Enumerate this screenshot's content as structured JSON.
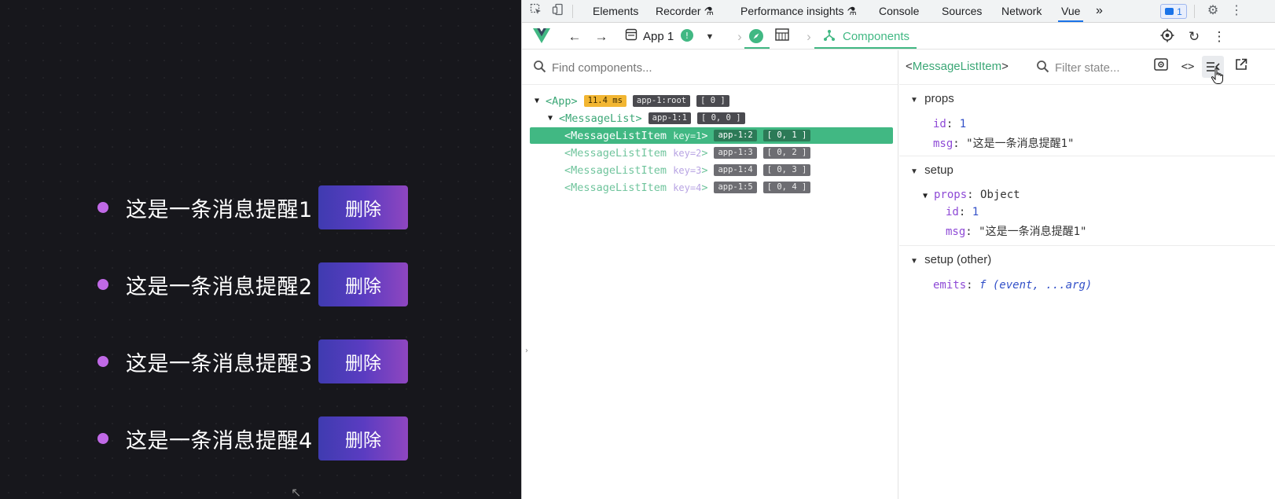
{
  "app": {
    "messages": [
      {
        "text": "这是一条消息提醒1",
        "delete_label": "删除"
      },
      {
        "text": "这是一条消息提醒2",
        "delete_label": "删除"
      },
      {
        "text": "这是一条消息提醒3",
        "delete_label": "删除"
      },
      {
        "text": "这是一条消息提醒4",
        "delete_label": "删除"
      }
    ]
  },
  "devtools": {
    "tabs": [
      {
        "label": "Elements"
      },
      {
        "label": "Recorder ⚗"
      },
      {
        "label": "Performance insights ⚗"
      },
      {
        "label": "Console"
      },
      {
        "label": "Sources"
      },
      {
        "label": "Network"
      },
      {
        "label": "Vue",
        "active": true
      }
    ],
    "more_tabs": "»",
    "issues_count": "1",
    "vue_toolbar": {
      "app_label": "App 1",
      "section_label": "Components"
    },
    "find_placeholder": "Find components...",
    "tree": [
      {
        "tag": "<App>",
        "badges": [
          "11.4 ms",
          "app-1:root",
          "[ 0 ]"
        ]
      },
      {
        "tag": "<MessageList>",
        "badges": [
          "app-1:1",
          "[ 0, 0 ]"
        ]
      },
      {
        "tag": "<MessageListItem",
        "key": "key=1",
        "close": ">",
        "badges": [
          "app-1:2",
          "[ 0, 1 ]"
        ],
        "selected": true
      },
      {
        "tag": "<MessageListItem",
        "key": "key=2",
        "close": ">",
        "badges": [
          "app-1:3",
          "[ 0, 2 ]"
        ]
      },
      {
        "tag": "<MessageListItem",
        "key": "key=3",
        "close": ">",
        "badges": [
          "app-1:4",
          "[ 0, 3 ]"
        ]
      },
      {
        "tag": "<MessageListItem",
        "key": "key=4",
        "close": ">",
        "badges": [
          "app-1:5",
          "[ 0, 4 ]"
        ]
      }
    ],
    "inspector": {
      "component_open": "<",
      "component_name": "MessageListItem",
      "component_close": ">",
      "filter_placeholder": "Filter state...",
      "sections": {
        "props": {
          "title": "props",
          "id_key": "id",
          "id_value": "1",
          "msg_key": "msg",
          "msg_value": "\"这是一条消息提醒1\""
        },
        "setup": {
          "title": "setup",
          "props_key": "props",
          "props_type": "Object",
          "id_key": "id",
          "id_value": "1",
          "msg_key": "msg",
          "msg_value": "\"这是一条消息提醒1\""
        },
        "setup_other": {
          "title": "setup (other)",
          "emits_key": "emits",
          "emits_value": "f (event, ...arg)"
        }
      }
    }
  },
  "colors": {
    "vue_green": "#41b883",
    "badge_yellow": "#f2b632",
    "dot_purple": "#c069e6",
    "button_gradient_start": "#3f3bb0",
    "button_gradient_end": "#8f46c0"
  }
}
